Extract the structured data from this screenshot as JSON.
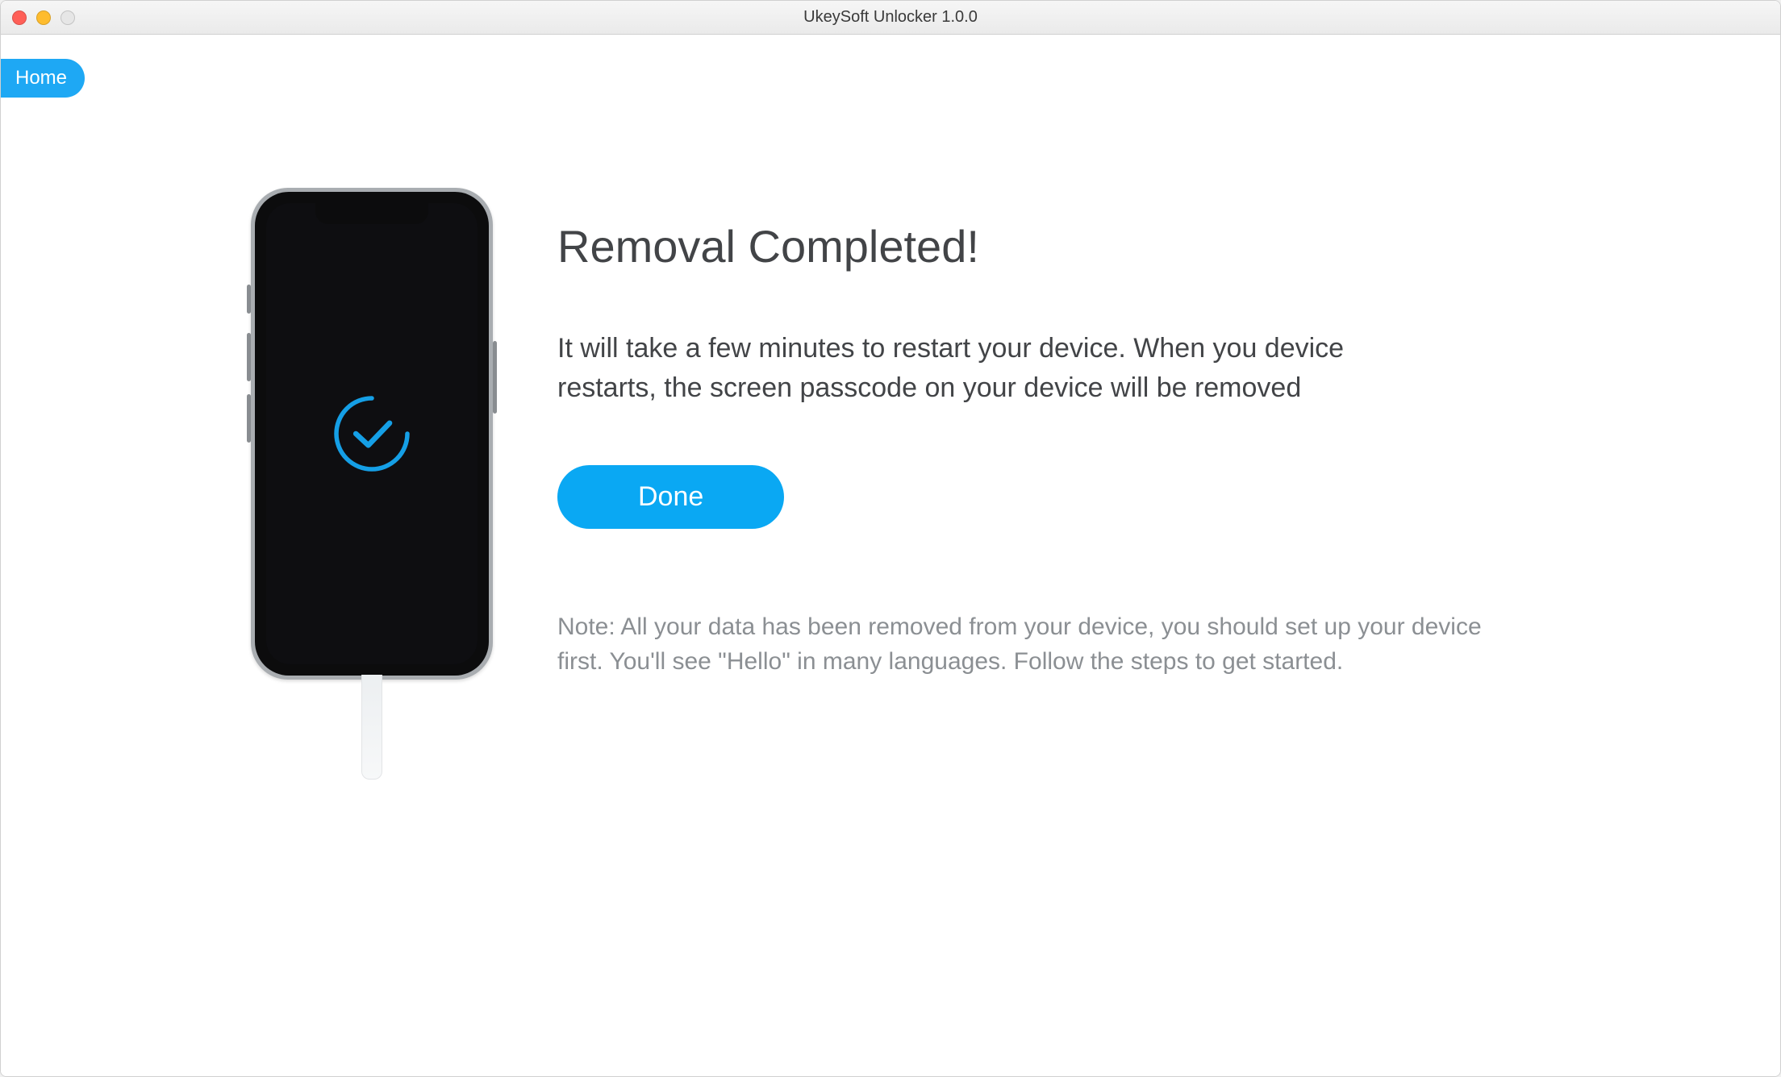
{
  "window": {
    "title": "UkeySoft Unlocker 1.0.0"
  },
  "nav": {
    "home_label": "Home"
  },
  "main": {
    "heading": "Removal Completed!",
    "description": "It will take a few minutes to restart your device. When you device restarts, the screen passcode on your device will be removed",
    "done_label": "Done",
    "note": "Note: All your data has been removed from your device, you should set up your device first. You'll see \"Hello\" in many languages. Follow the steps to get started."
  },
  "colors": {
    "accent": "#0aa8f3",
    "text": "#424447",
    "muted": "#8b8f93"
  },
  "icons": {
    "check_circle": "check-circle-icon",
    "phone": "phone-icon"
  }
}
